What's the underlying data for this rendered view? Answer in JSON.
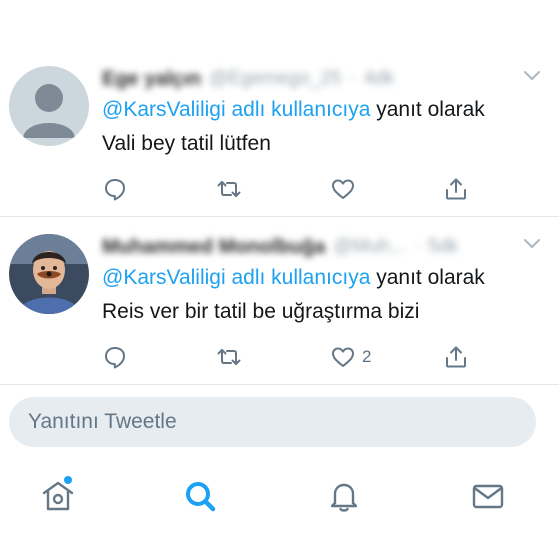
{
  "tweets": [
    {
      "name": "Ege yalçın",
      "handle": "@Egemego_25",
      "time": "4dk",
      "reply_mention": "@KarsValiligi adlı kullanıcıya",
      "reply_suffix": "yanıt olarak",
      "text": "Vali bey tatil lütfen",
      "like_count": ""
    },
    {
      "name": "Muhammed Monolbuğa",
      "handle": "@Muh...",
      "time": "5dk",
      "reply_mention": "@KarsValiligi adlı kullanıcıya",
      "reply_suffix": "yanıt olarak",
      "text": "Reis ver bir tatil be uğraştırma bizi",
      "like_count": "2"
    }
  ],
  "reply_box": {
    "placeholder": "Yanıtını Tweetle"
  },
  "tabs": [
    "home-icon",
    "search-icon",
    "notifications-icon",
    "messages-icon"
  ],
  "colors": {
    "accent": "#1da1f2",
    "icon_gray": "#657786",
    "divider": "#e1e8ed"
  }
}
